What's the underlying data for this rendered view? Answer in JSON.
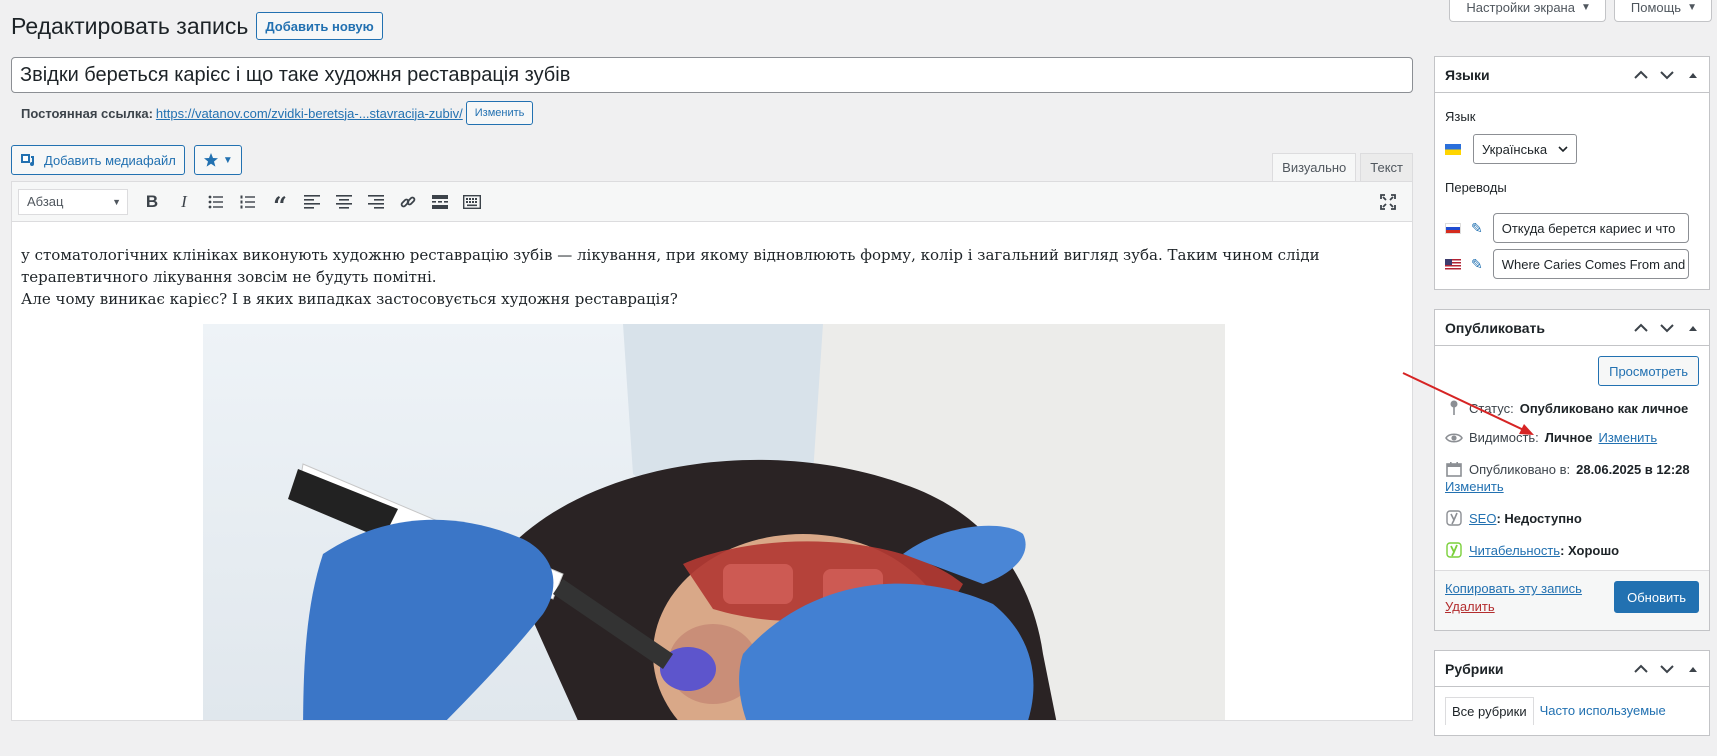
{
  "screen_tabs": {
    "screen_options": "Настройки экрана",
    "help": "Помощь"
  },
  "header": {
    "title": "Редактировать запись",
    "add_new": "Добавить новую"
  },
  "post": {
    "title": "Звідки береться карієс і що таке художня реставрація зубів",
    "permalink_label": "Постоянная ссылка:",
    "permalink_url": "https://vatanov.com/zvidki-beretsja-...stavracija-zubiv/",
    "permalink_edit": "Изменить"
  },
  "editor": {
    "add_media": "Добавить медиафайл",
    "tab_visual": "Визуально",
    "tab_text": "Текст",
    "format": "Абзац",
    "paragraph1": "у стоматологічних клініках виконують художню реставрацію зубів — лікування, при якому відновлюють форму, колір і загальний вигляд зуба. Таким чином сліди терапевтичного лікування зовсім не будуть помітні.",
    "paragraph2": "Але чому виникає карієс? І в яких випадках застосовується художня реставрація?"
  },
  "languages": {
    "title": "Языки",
    "language_label": "Язык",
    "language_value": "Українська",
    "translations_label": "Переводы",
    "translation_ru": "Откуда берется кариес и что",
    "translation_en": "Where Caries Comes From and"
  },
  "publish": {
    "title": "Опубликовать",
    "preview": "Просмотреть",
    "status_label": "Статус:",
    "status_value": "Опубликовано как личное",
    "visibility_label": "Видимость:",
    "visibility_value": "Личное",
    "visibility_edit": "Изменить",
    "published_label": "Опубликовано в:",
    "published_value": "28.06.2025 в 12:28",
    "published_edit": "Изменить",
    "seo_link": "SEO",
    "seo_value": ": Недоступно",
    "readability_link": "Читабельность",
    "readability_value": ": Хорошо",
    "copy": "Копировать эту запись",
    "delete": "Удалить",
    "update": "Обновить"
  },
  "categories": {
    "title": "Рубрики",
    "tab_all": "Все рубрики",
    "tab_popular": "Часто используемые"
  },
  "colors": {
    "accent": "#2271b1",
    "annotation_arrow": "#d62424"
  }
}
